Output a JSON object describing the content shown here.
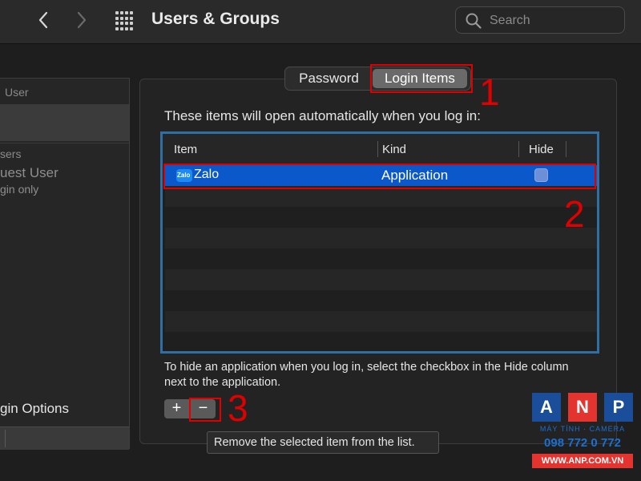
{
  "window": {
    "title": "Users & Groups",
    "search_placeholder": "Search"
  },
  "sidebar": {
    "header_current": "User",
    "header_other": "sers",
    "guest_name": "uest User",
    "guest_sub": "gin only",
    "login_options": "gin Options"
  },
  "tabs": [
    {
      "label": "Password",
      "selected": false
    },
    {
      "label": "Login Items",
      "selected": true
    }
  ],
  "main": {
    "description": "These items will open automatically when you log in:",
    "columns": [
      "Item",
      "Kind",
      "Hide"
    ],
    "rows": [
      {
        "icon": "zalo-app-icon",
        "icon_text": "Zalo",
        "name": "Zalo",
        "kind": "Application",
        "hide": false,
        "selected": true
      }
    ],
    "hint": "To hide an application when you log in, select the checkbox in the Hide column next to the application.",
    "add_label": "+",
    "remove_label": "−",
    "tooltip": "Remove the selected item from the list."
  },
  "annotations": {
    "step1": "1",
    "step2": "2",
    "step3": "3",
    "color": "#e10000"
  },
  "watermark": {
    "letters": [
      "A",
      "N",
      "P"
    ],
    "tagline": "MÁY TÍNH · CAMERA",
    "phone": "098 772 0 772",
    "url": "WWW.ANP.COM.VN",
    "colors": [
      "#1a4e9a",
      "#e3342f",
      "#1a4e9a"
    ]
  },
  "colors": {
    "selection": "#0a58ca",
    "table_border": "#2f6fa4",
    "segment_selected": "#6a6a6a"
  }
}
